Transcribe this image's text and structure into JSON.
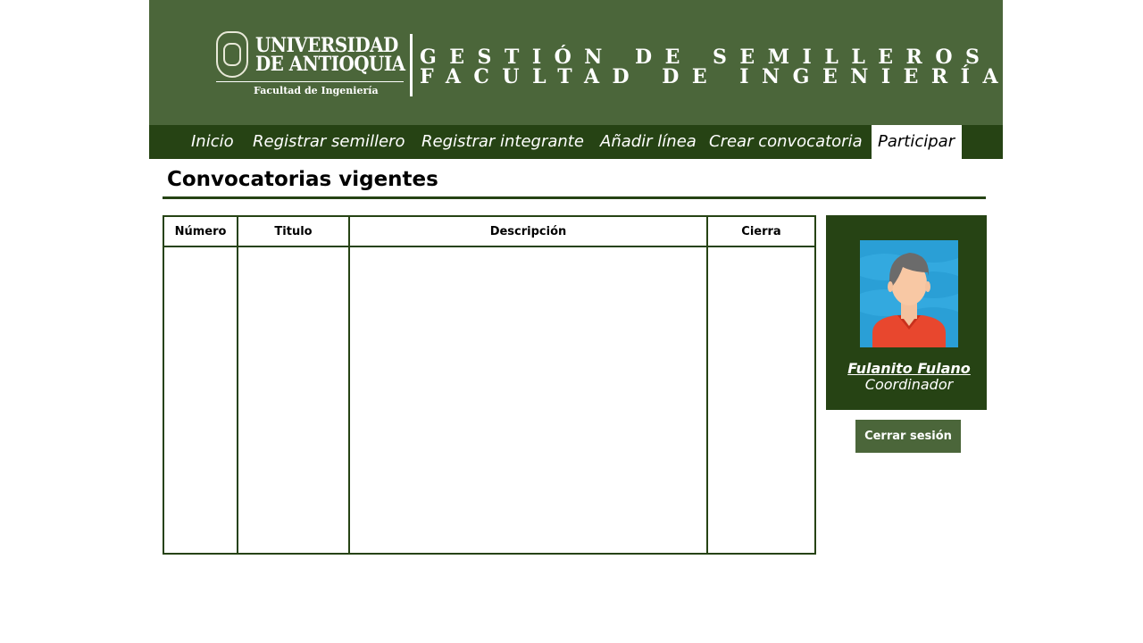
{
  "header": {
    "university_line_1": "UNIVERSIDAD",
    "university_line_2": "DE ANTIOQUIA",
    "faculty_logo_text": "Facultad de Ingeniería",
    "system_title_1": "GESTIÓN DE SEMILLEROS",
    "system_title_2": "FACULTAD DE INGENIERÍA"
  },
  "nav": {
    "items": [
      {
        "label": "Inicio"
      },
      {
        "label": "Registrar semillero"
      },
      {
        "label": "Registrar integrante"
      },
      {
        "label": "Añadir línea"
      },
      {
        "label": "Crear convocatoria"
      },
      {
        "label": "Participar"
      }
    ],
    "active": "Participar"
  },
  "main": {
    "title": "Convocatorias vigentes",
    "table": {
      "columns": [
        "Número",
        "Titulo",
        "Descripción",
        "Cierra"
      ],
      "rows": []
    }
  },
  "profile": {
    "name": "Fulanito Fulano",
    "role": "Coordinador",
    "avatar_icon": "user-avatar-icon"
  },
  "actions": {
    "logout_label": "Cerrar sesión"
  },
  "colors": {
    "header_bg": "#4b663a",
    "nav_bg": "#264314",
    "accent_dark": "#264314",
    "button_bg": "#4b663a"
  }
}
